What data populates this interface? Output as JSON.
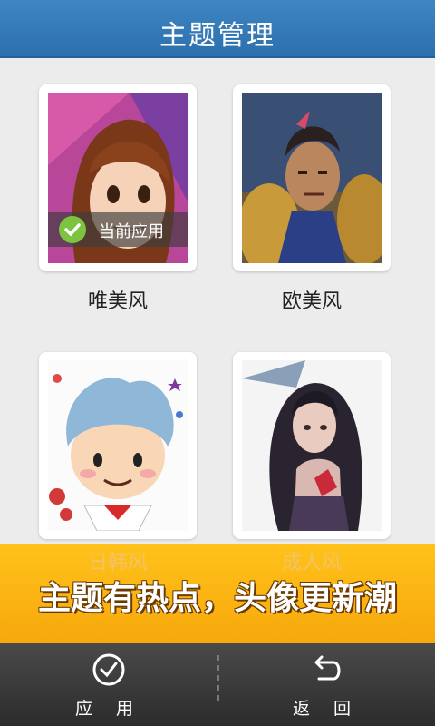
{
  "header": {
    "title": "主题管理"
  },
  "themes": [
    {
      "label": "唯美风",
      "current": true,
      "badge": "当前应用"
    },
    {
      "label": "欧美风",
      "current": false
    },
    {
      "label": "日韩风",
      "current": false
    },
    {
      "label": "成人风",
      "current": false
    }
  ],
  "banner": {
    "text": "主题有热点，头像更新潮"
  },
  "bottom": {
    "apply_label": "应 用",
    "back_label": "返 回"
  },
  "colors": {
    "header": "#3479b8",
    "banner": "#f9b213",
    "check": "#7cc43f",
    "bottom_bar": "#3a3a3a"
  }
}
